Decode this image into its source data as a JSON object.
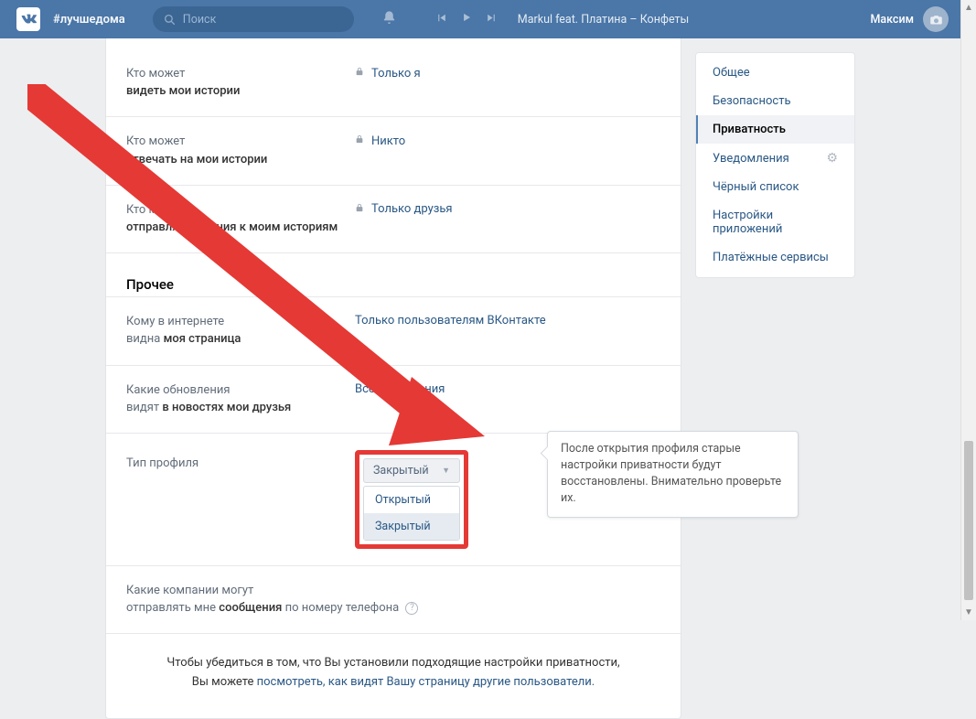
{
  "header": {
    "hashtag": "#лучшедома",
    "search_placeholder": "Поиск",
    "track": "Markul feat. Платина – Конфеты",
    "username": "Максим"
  },
  "sidebar": {
    "items": [
      {
        "label": "Общее"
      },
      {
        "label": "Безопасность"
      },
      {
        "label": "Приватность"
      },
      {
        "label": "Уведомления"
      },
      {
        "label": "Чёрный список"
      },
      {
        "label": "Настройки приложений"
      },
      {
        "label": "Платёжные сервисы"
      }
    ]
  },
  "settings": {
    "rows": [
      {
        "label1": "Кто может",
        "label2": "видеть мои истории",
        "value": "Только я",
        "lock": true
      },
      {
        "label1": "Кто может",
        "label2": "отвечать на мои истории",
        "value": "Никто",
        "lock": true
      },
      {
        "label1": "Кто может",
        "label2": "отправлять мнения к моим историям",
        "value": "Только друзья",
        "lock": true
      }
    ],
    "section": "Прочее",
    "other_rows": [
      {
        "label1": "Кому в интернете",
        "label2": "видна моя страница",
        "value": "Только пользователям ВКонтакте"
      },
      {
        "label1": "Какие обновления",
        "label2": "видят в новостях мои друзья",
        "value": "Все обновления"
      },
      {
        "label_full": "Тип профиля"
      },
      {
        "label_full": "Какие компании могут",
        "label_full2": "отправлять мне сообщения по номеру телефона"
      }
    ],
    "dropdown": {
      "current": "Закрытый",
      "options": [
        "Открытый",
        "Закрытый"
      ]
    },
    "tooltip": "После открытия профиля старые настройки приватности будут восстановлены. Внимательно проверьте их.",
    "label_companies_1": "Какие компании могут",
    "label_companies_2a": "отправлять мне ",
    "label_companies_2b": "сообщения",
    "label_companies_2c": " по номеру телефона",
    "footer1": "Чтобы убедиться в том, что Вы установили подходящие настройки приватности,",
    "footer2a": "Вы можете ",
    "footer2b": "посмотреть, как видят Вашу страницу другие пользователи."
  }
}
